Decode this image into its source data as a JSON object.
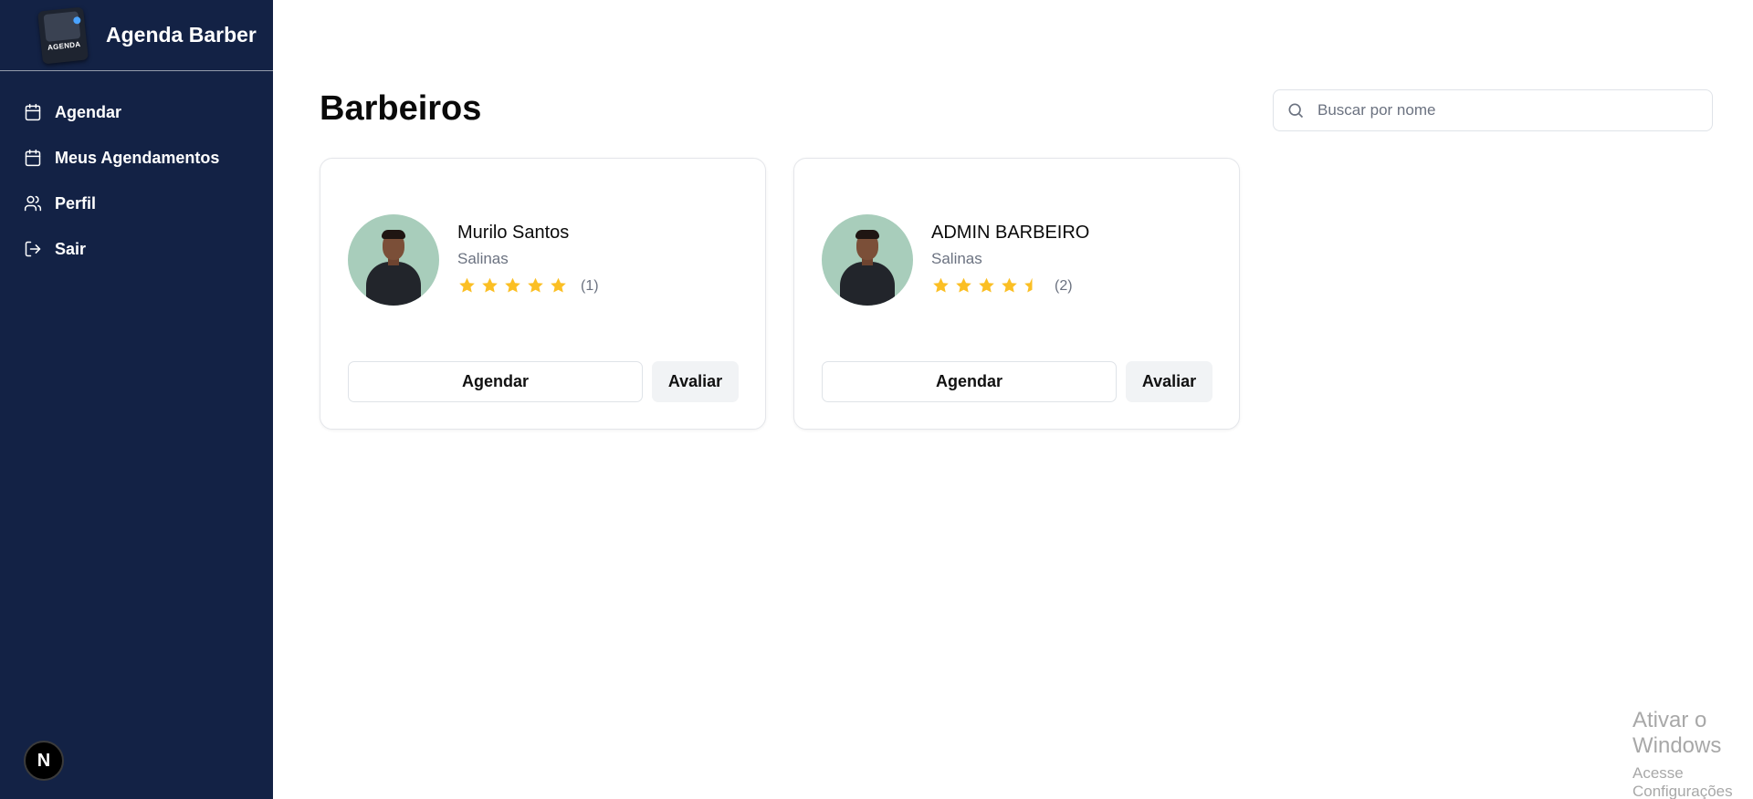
{
  "brand": {
    "title": "Agenda Barber",
    "logo_text": "AGENDA"
  },
  "sidebar": {
    "items": [
      {
        "label": "Agendar",
        "icon": "calendar-icon"
      },
      {
        "label": "Meus Agendamentos",
        "icon": "calendar-icon"
      },
      {
        "label": "Perfil",
        "icon": "users-icon"
      },
      {
        "label": "Sair",
        "icon": "logout-icon"
      }
    ],
    "badge": "N"
  },
  "main": {
    "title": "Barbeiros",
    "search": {
      "placeholder": "Buscar por nome",
      "value": ""
    }
  },
  "barbers": [
    {
      "name": "Murilo Santos",
      "city": "Salinas",
      "rating": 5,
      "reviews": "(1)",
      "book_label": "Agendar",
      "rate_label": "Avaliar"
    },
    {
      "name": "ADMIN BARBEIRO",
      "city": "Salinas",
      "rating": 4.5,
      "reviews": "(2)",
      "book_label": "Agendar",
      "rate_label": "Avaliar"
    }
  ],
  "colors": {
    "sidebar_bg": "#132245",
    "star": "#fbbf24"
  },
  "watermark": {
    "line1": "Ativar o Windows",
    "line2": "Acesse Configurações para ativar o Windows."
  }
}
